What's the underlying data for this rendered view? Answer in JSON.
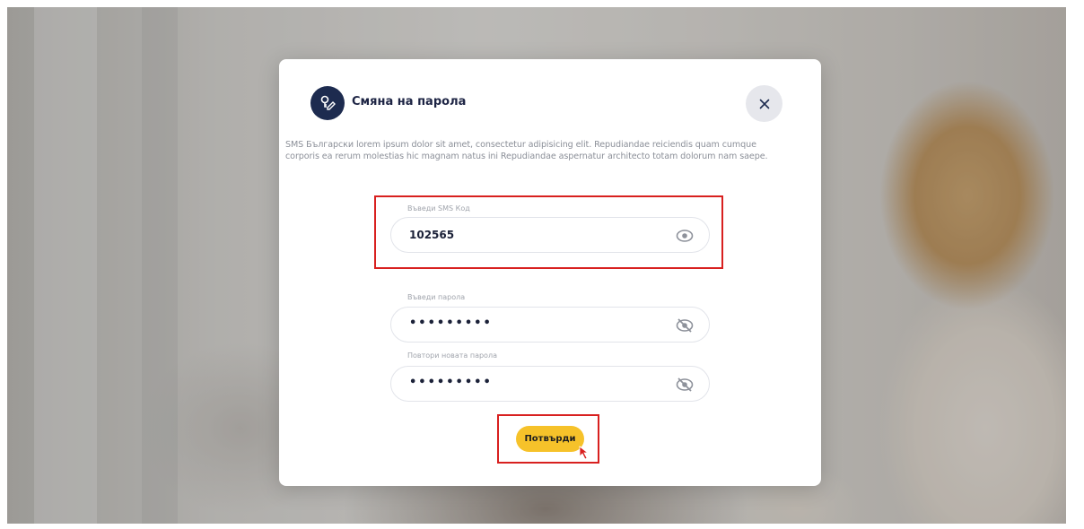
{
  "modal": {
    "title": "Смяна на парола",
    "description": "SMS Български lorem ipsum dolor sit amet, consectetur adipisicing elit. Repudiandae reiciendis quam cumque corporis ea rerum molestias hic magnam natus ini Repudiandae aspernatur architecto totam dolorum nam saepe.",
    "close_icon": "close-icon",
    "header_icon": "key-edit-icon"
  },
  "form": {
    "sms_code": {
      "label": "Въведи SMS Код",
      "value": "102565",
      "icon": "eye-icon"
    },
    "password": {
      "label": "Въведи парола",
      "value": "•••••••••",
      "icon": "eye-off-icon"
    },
    "password_repeat": {
      "label": "Повтори новата парола",
      "value": "•••••••••",
      "icon": "eye-off-icon"
    },
    "confirm_label": "Потвърди"
  },
  "colors": {
    "primary_dark": "#1d2b4f",
    "accent_yellow": "#f6c22a",
    "highlight_red": "#d8201f"
  }
}
